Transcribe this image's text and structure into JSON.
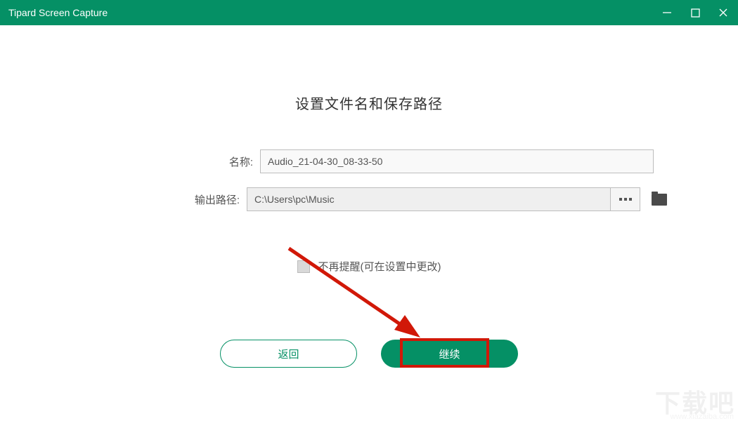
{
  "titlebar": {
    "title": "Tipard Screen Capture"
  },
  "heading": "设置文件名和保存路径",
  "form": {
    "name_label": "名称:",
    "name_value": "Audio_21-04-30_08-33-50",
    "path_label": "输出路径:",
    "path_value": "C:\\Users\\pc\\Music"
  },
  "reminder": {
    "label": "不再提醒(可在设置中更改)"
  },
  "buttons": {
    "back": "返回",
    "continue": "继续"
  },
  "watermark": {
    "main": "下载吧",
    "sub": "www.xiazaiba.com"
  },
  "colors": {
    "accent": "#059065",
    "highlight": "#d11808"
  }
}
